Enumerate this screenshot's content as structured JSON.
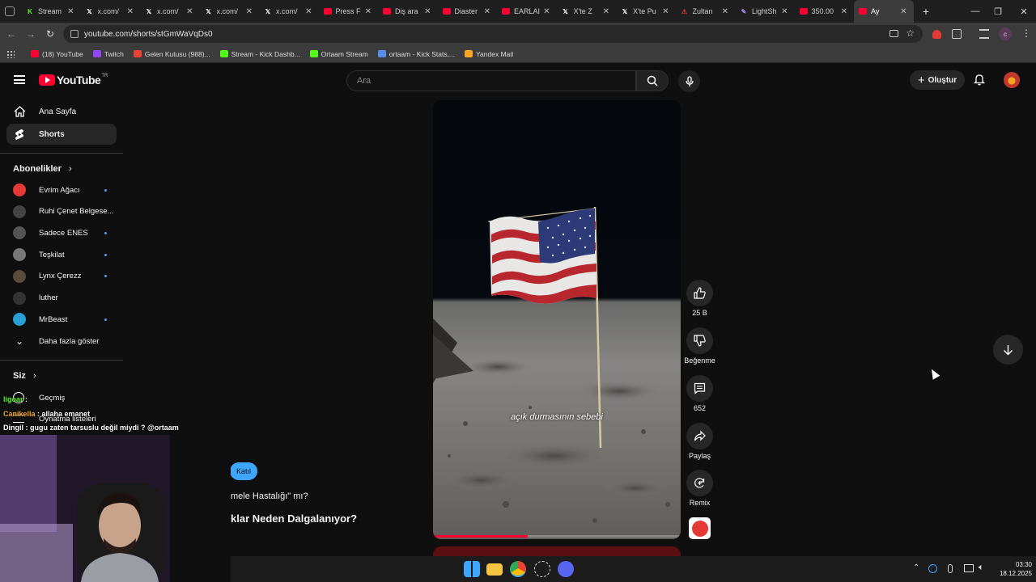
{
  "browser": {
    "tabs": [
      {
        "title": "Stream",
        "icon": "kick-icon",
        "color": "#53fc18"
      },
      {
        "title": "x.com/",
        "icon": "x-icon",
        "color": "#ffffff"
      },
      {
        "title": "x.com/",
        "icon": "x-icon",
        "color": "#ffffff"
      },
      {
        "title": "x.com/",
        "icon": "x-icon",
        "color": "#ffffff"
      },
      {
        "title": "x.com/",
        "icon": "x-icon",
        "color": "#ffffff"
      },
      {
        "title": "Press F",
        "icon": "youtube-icon",
        "color": "#ff0033"
      },
      {
        "title": "Diş ara",
        "icon": "youtube-icon",
        "color": "#ff0033"
      },
      {
        "title": "Diaster",
        "icon": "youtube-icon",
        "color": "#ff0033"
      },
      {
        "title": "EARLAI",
        "icon": "youtube-icon",
        "color": "#ff0033"
      },
      {
        "title": "X'te Z",
        "icon": "x-icon",
        "color": "#ffffff"
      },
      {
        "title": "X'te Pu",
        "icon": "x-icon",
        "color": "#ffffff"
      },
      {
        "title": "Zultan",
        "icon": "warning-icon",
        "color": "#e53935"
      },
      {
        "title": "LightSh",
        "icon": "feather-icon",
        "color": "#a78bfa"
      },
      {
        "title": "350.00",
        "icon": "youtube-icon",
        "color": "#ff0033"
      },
      {
        "title": "Ay",
        "icon": "youtube-icon",
        "color": "#ff0033"
      }
    ],
    "url": "youtube.com/shorts/stGmWaVqDs0",
    "bookmarks": [
      {
        "label": "(18) YouTube",
        "color": "#ff0033"
      },
      {
        "label": "Twitch",
        "color": "#9146ff"
      },
      {
        "label": "Gelen Kutusu (988)...",
        "color": "#ea4335"
      },
      {
        "label": "Stream - Kick Dashb...",
        "color": "#53fc18"
      },
      {
        "label": "Ortaam Stream",
        "color": "#53fc18"
      },
      {
        "label": "ortaam - Kick Stats,...",
        "color": "#5a8dee"
      },
      {
        "label": "Yandex Mail",
        "color": "#f5a623"
      }
    ]
  },
  "youtube": {
    "logo": "YouTube",
    "country_code": "TR",
    "search_placeholder": "Ara",
    "create_label": "Oluştur",
    "sidebar": {
      "home": "Ana Sayfa",
      "shorts": "Shorts",
      "subscriptions_header": "Abonelikler",
      "subscriptions": [
        {
          "name": "Evrim Ağacı",
          "new": true,
          "color": "#e53935"
        },
        {
          "name": "Ruhi Çenet Belgese...",
          "new": false,
          "color": "#444444"
        },
        {
          "name": "Sadece ENES",
          "new": true,
          "color": "#555555"
        },
        {
          "name": "Teşkilat",
          "new": true,
          "color": "#777777"
        },
        {
          "name": "Lynx Çerezz",
          "new": true,
          "color": "#5a4a3a"
        },
        {
          "name": "luther",
          "new": false,
          "color": "#333333"
        },
        {
          "name": "MrBeast",
          "new": true,
          "color": "#2a9fd6"
        }
      ],
      "show_more": "Daha fazla göster",
      "you_header": "Siz",
      "history": "Geçmiş",
      "playlists": "Oynatma listeleri"
    },
    "short": {
      "caption": "açık durmasının sebebi",
      "likes": "25 B",
      "dislike_label": "Beğenme",
      "comments": "652",
      "share_label": "Paylaş",
      "remix_label": "Remix"
    },
    "join_label": "Katıl",
    "left_text_1": "mele Hastalığı\" mı?",
    "left_text_2": "klar Neden Dalgalanıyor?"
  },
  "stream_chat": [
    {
      "user": "ligoar",
      "message": "",
      "user_color": "#53fc18"
    },
    {
      "user": "Canikella",
      "message": "allaha emanet",
      "user_color": "#f5a623"
    },
    {
      "user": "Dingil",
      "message": "gugu zaten tarsuslu değil miydi ? @ortaam",
      "user_color": "#ffffff"
    }
  ],
  "taskbar": {
    "time": "03:30",
    "date": "18.12.2025"
  }
}
